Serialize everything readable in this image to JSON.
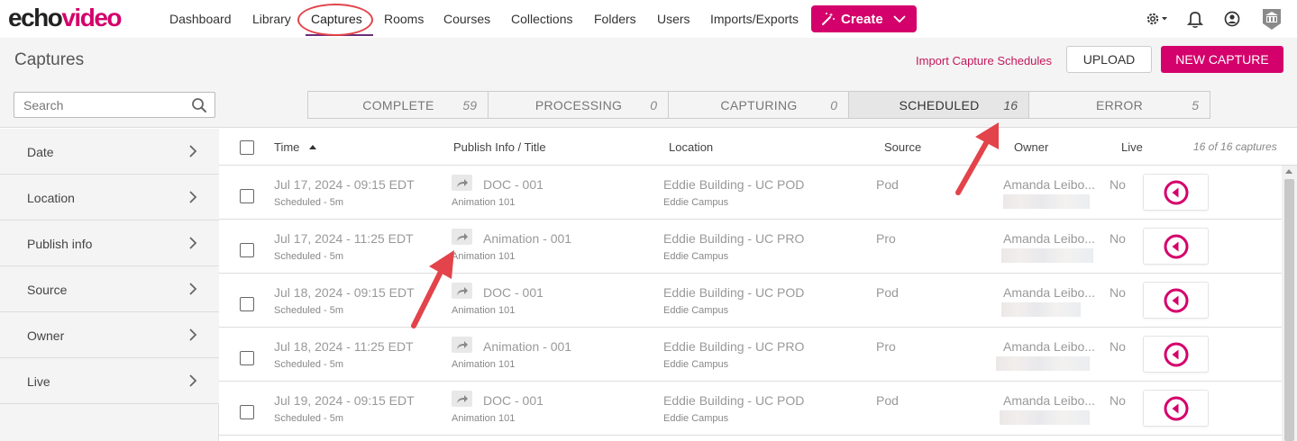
{
  "nav": {
    "logo_part1": "echo",
    "logo_part2": "video",
    "links": [
      "Dashboard",
      "Library",
      "Captures",
      "Rooms",
      "Courses",
      "Collections",
      "Folders",
      "Users",
      "Imports/Exports"
    ],
    "active_link": "Captures",
    "create_label": "Create"
  },
  "header": {
    "title": "Captures",
    "import_link": "Import Capture Schedules",
    "upload_label": "UPLOAD",
    "new_capture_label": "NEW CAPTURE"
  },
  "search": {
    "placeholder": "Search"
  },
  "status_tabs": [
    {
      "label": "COMPLETE",
      "count": "59"
    },
    {
      "label": "PROCESSING",
      "count": "0"
    },
    {
      "label": "CAPTURING",
      "count": "0"
    },
    {
      "label": "SCHEDULED",
      "count": "16"
    },
    {
      "label": "ERROR",
      "count": "5"
    }
  ],
  "selected_status": "SCHEDULED",
  "sidebar_filters": [
    "Date",
    "Location",
    "Publish info",
    "Source",
    "Owner",
    "Live"
  ],
  "table": {
    "headers": {
      "time": "Time",
      "publish": "Publish Info / Title",
      "location": "Location",
      "source": "Source",
      "owner": "Owner",
      "live": "Live"
    },
    "count_label": "16 of 16 captures",
    "rows": [
      {
        "time": "Jul 17, 2024 - 09:15 EDT",
        "scheduled": "Scheduled - 5m",
        "title": "DOC - 001",
        "course": "Animation 101",
        "location": "Eddie Building - UC POD",
        "campus": "Eddie Campus",
        "source": "Pod",
        "owner": "Amanda Leibo...",
        "live": "No"
      },
      {
        "time": "Jul 17, 2024 - 11:25 EDT",
        "scheduled": "Scheduled - 5m",
        "title": "Animation - 001",
        "course": "Animation 101",
        "location": "Eddie Building - UC PRO",
        "campus": "Eddie Campus",
        "source": "Pro",
        "owner": "Amanda Leibo...",
        "live": "No"
      },
      {
        "time": "Jul 18, 2024 - 09:15 EDT",
        "scheduled": "Scheduled - 5m",
        "title": "DOC - 001",
        "course": "Animation 101",
        "location": "Eddie Building - UC POD",
        "campus": "Eddie Campus",
        "source": "Pod",
        "owner": "Amanda Leibo...",
        "live": "No"
      },
      {
        "time": "Jul 18, 2024 - 11:25 EDT",
        "scheduled": "Scheduled - 5m",
        "title": "Animation - 001",
        "course": "Animation 101",
        "location": "Eddie Building - UC PRO",
        "campus": "Eddie Campus",
        "source": "Pro",
        "owner": "Amanda Leibo...",
        "live": "No"
      },
      {
        "time": "Jul 19, 2024 - 09:15 EDT",
        "scheduled": "Scheduled - 5m",
        "title": "DOC - 001",
        "course": "Animation 101",
        "location": "Eddie Building - UC POD",
        "campus": "Eddie Campus",
        "source": "Pod",
        "owner": "Amanda Leibo...",
        "live": "No"
      }
    ]
  },
  "colors": {
    "brand": "#d4006b",
    "annotation": "#e3434a",
    "active_underline": "#6b2d7b"
  }
}
